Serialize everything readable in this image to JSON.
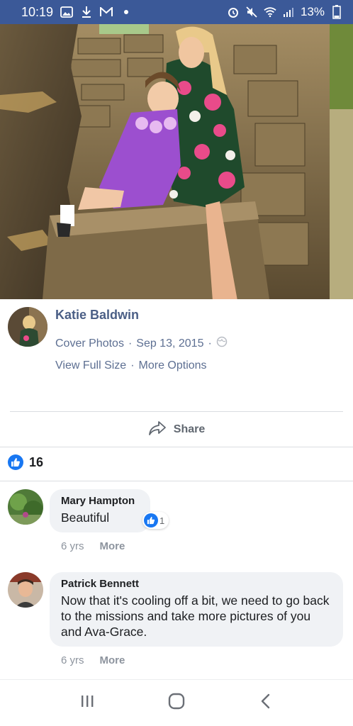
{
  "status_bar": {
    "time": "10:19",
    "battery": "13%"
  },
  "post": {
    "poster_name": "Katie Baldwin",
    "album": "Cover Photos",
    "date": "Sep 13, 2015",
    "separator": "·",
    "view_full_size": "View Full Size",
    "more_options": "More Options",
    "share_label": "Share",
    "like_count": "16"
  },
  "comments": [
    {
      "author": "Mary Hampton",
      "text": "Beautiful",
      "reactions": "1",
      "age": "6 yrs",
      "more": "More"
    },
    {
      "author": "Patrick Bennett",
      "text": "Now that it's cooling off a bit, we need to go back to the missions and take more pictures of you and Ava-Grace.",
      "age": "6 yrs",
      "more": "More"
    }
  ],
  "colors": {
    "status_bar_bg": "#3b5998",
    "link": "#4b5f86",
    "like_blue": "#1877f2",
    "bubble_bg": "#f0f2f5"
  },
  "icons": [
    "gallery-icon",
    "download-icon",
    "gmail-icon",
    "alarm-icon",
    "mute-icon",
    "wifi-icon",
    "signal-icon",
    "battery-icon",
    "globe-icon",
    "share-icon",
    "like-icon",
    "recent-apps-icon",
    "home-icon",
    "back-icon"
  ]
}
